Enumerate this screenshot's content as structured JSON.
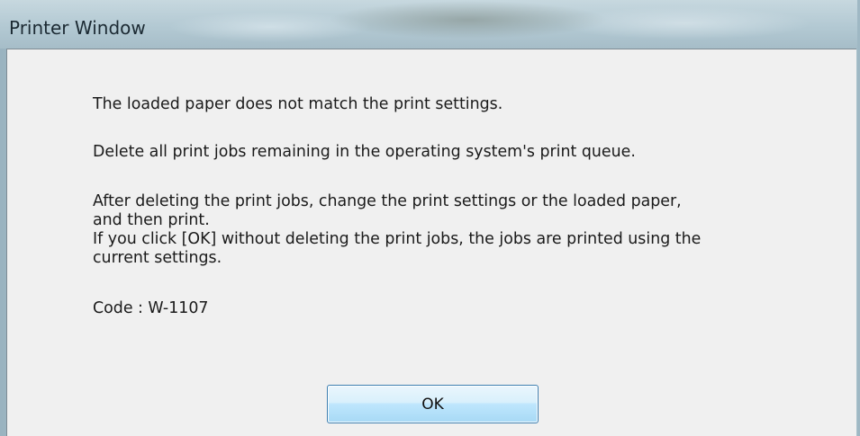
{
  "window": {
    "title": "Printer Window"
  },
  "dialog": {
    "message_1": "The loaded paper does not match the print settings.",
    "message_2": "Delete all print jobs remaining in the operating system's print queue.",
    "message_3_line_1": "After deleting the print jobs, change the print settings or the loaded paper,",
    "message_3_line_2": "and then print.",
    "message_3_line_3": "If you click [OK] without deleting the print jobs, the jobs are printed using the",
    "message_3_line_4": "current settings.",
    "code": "Code : W-1107",
    "ok_label": "OK"
  },
  "colors": {
    "dialog_background": "#f0f0f0",
    "button_border": "#3c7fb1",
    "text": "#1a1a1a"
  }
}
